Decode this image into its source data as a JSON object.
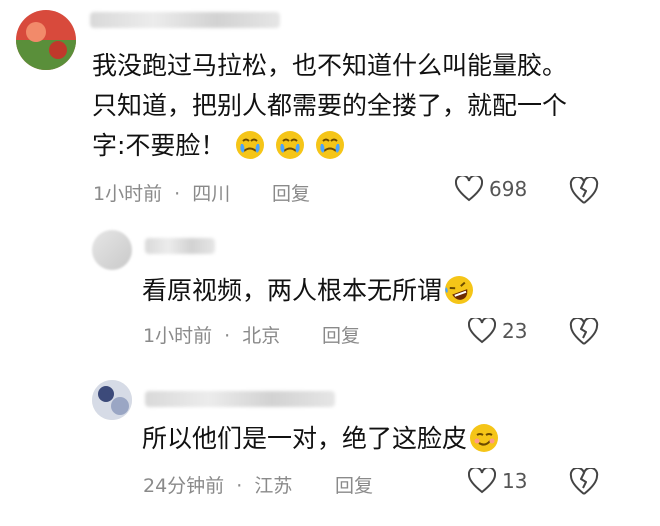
{
  "comments": [
    {
      "text_lines": [
        "我没跑过马拉松，也不知道什么叫能量胶。",
        "只知道，把别人都需要的全搂了，就配一个",
        "字:不要脸！"
      ],
      "emoji_icons": [
        "crying-face-icon",
        "crying-face-icon",
        "crying-face-icon"
      ],
      "time": "1小时前",
      "location": "四川",
      "reply_label": "回复",
      "like_count": "698"
    },
    {
      "text": "看原视频，两人根本无所谓",
      "emoji_icons": [
        "rofl-face-icon"
      ],
      "time": "1小时前",
      "location": "北京",
      "reply_label": "回复",
      "like_count": "23"
    },
    {
      "text": "所以他们是一对，绝了这脸皮",
      "emoji_icons": [
        "smirk-face-icon"
      ],
      "time": "24分钟前",
      "location": "江苏",
      "reply_label": "回复",
      "like_count": "13"
    }
  ],
  "meta_separator": "·",
  "colors": {
    "text": "#111111",
    "meta": "#8a8a8a",
    "emoji": "#f5c518"
  }
}
